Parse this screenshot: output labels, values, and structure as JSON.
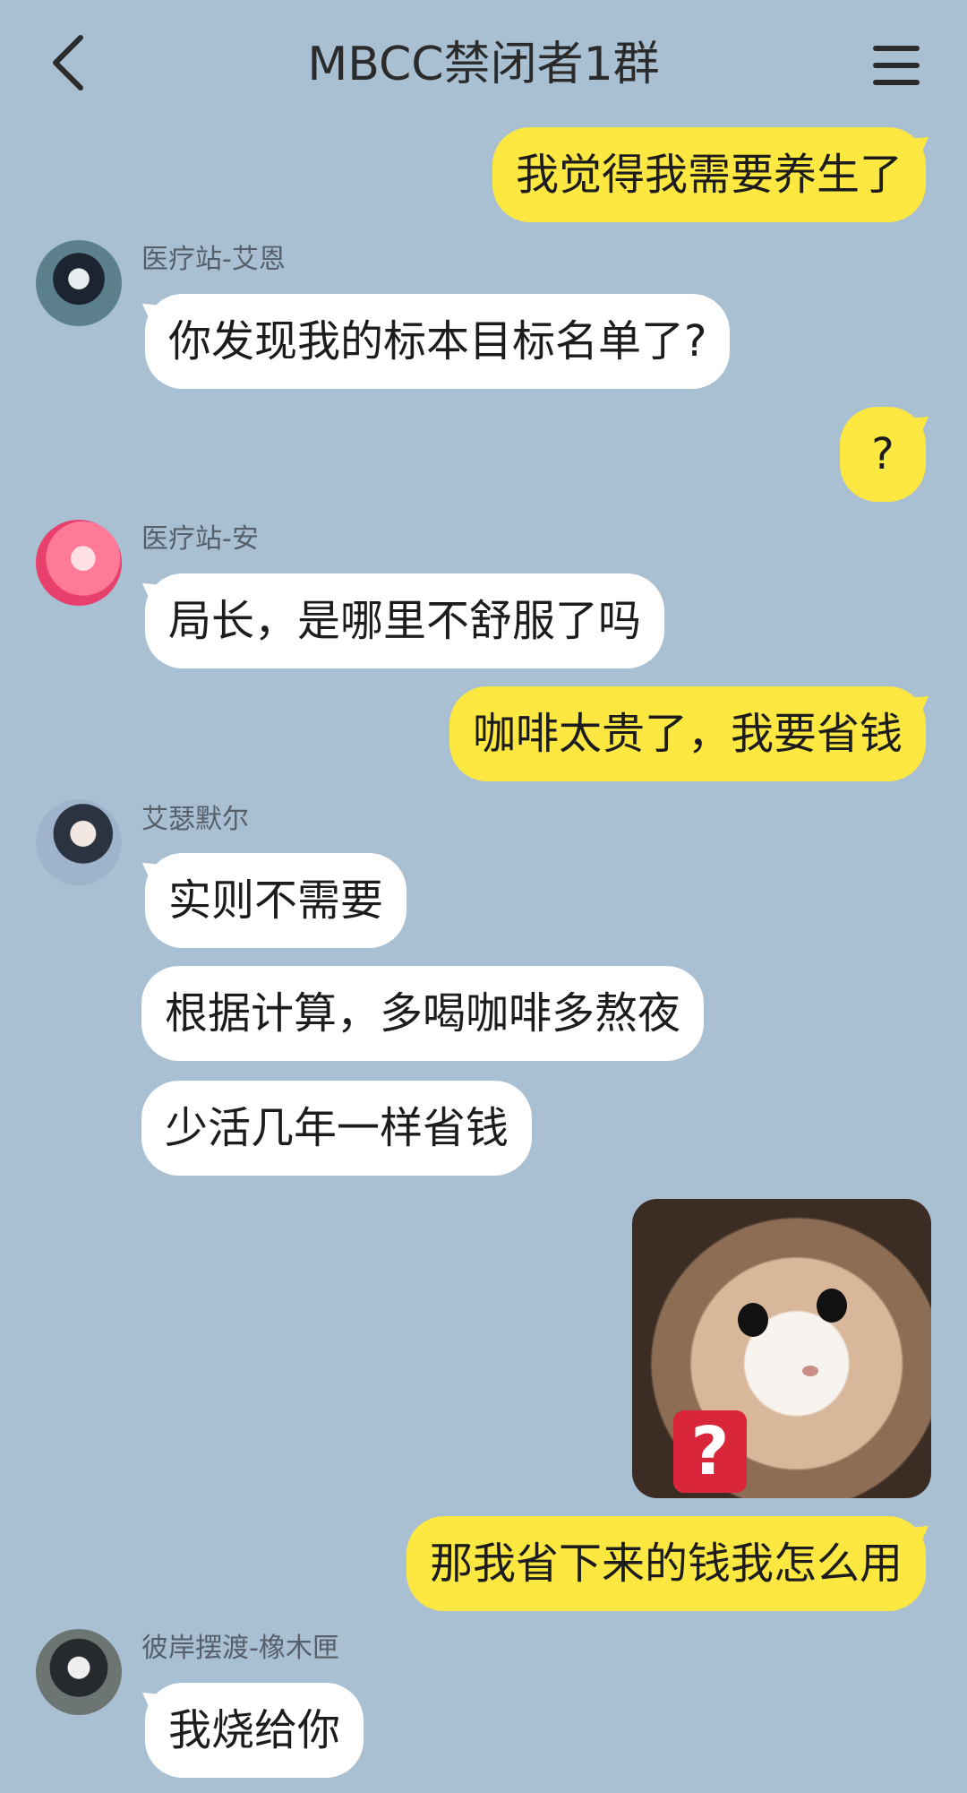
{
  "header": {
    "title": "MBCC禁闭者1群",
    "back_icon": "chevron-left-icon",
    "menu_icon": "hamburger-menu-icon"
  },
  "colors": {
    "background": "#a9bfd2",
    "my_bubble": "#fde842",
    "their_bubble": "#ffffff"
  },
  "messages": [
    {
      "from": "me",
      "text": "我觉得我需要养生了"
    },
    {
      "from": "them",
      "sender": "医疗站-艾恩",
      "text": "你发现我的标本目标名单了?"
    },
    {
      "from": "me",
      "text": "?"
    },
    {
      "from": "them",
      "sender": "医疗站-安",
      "text": "局长，是哪里不舒服了吗"
    },
    {
      "from": "me",
      "text": "咖啡太贵了，我要省钱"
    },
    {
      "from": "them",
      "sender": "艾瑟默尔",
      "text": "实则不需要"
    },
    {
      "from": "them",
      "text": "根据计算，多喝咖啡多熬夜"
    },
    {
      "from": "them",
      "text": "少活几年一样省钱"
    },
    {
      "from": "me",
      "sticker": "crying-kitten-question-sticker",
      "text": "?"
    },
    {
      "from": "me",
      "text": "那我省下来的钱我怎么用"
    },
    {
      "from": "them",
      "sender": "彼岸摆渡-橡木匣",
      "text": "我烧给你"
    }
  ]
}
